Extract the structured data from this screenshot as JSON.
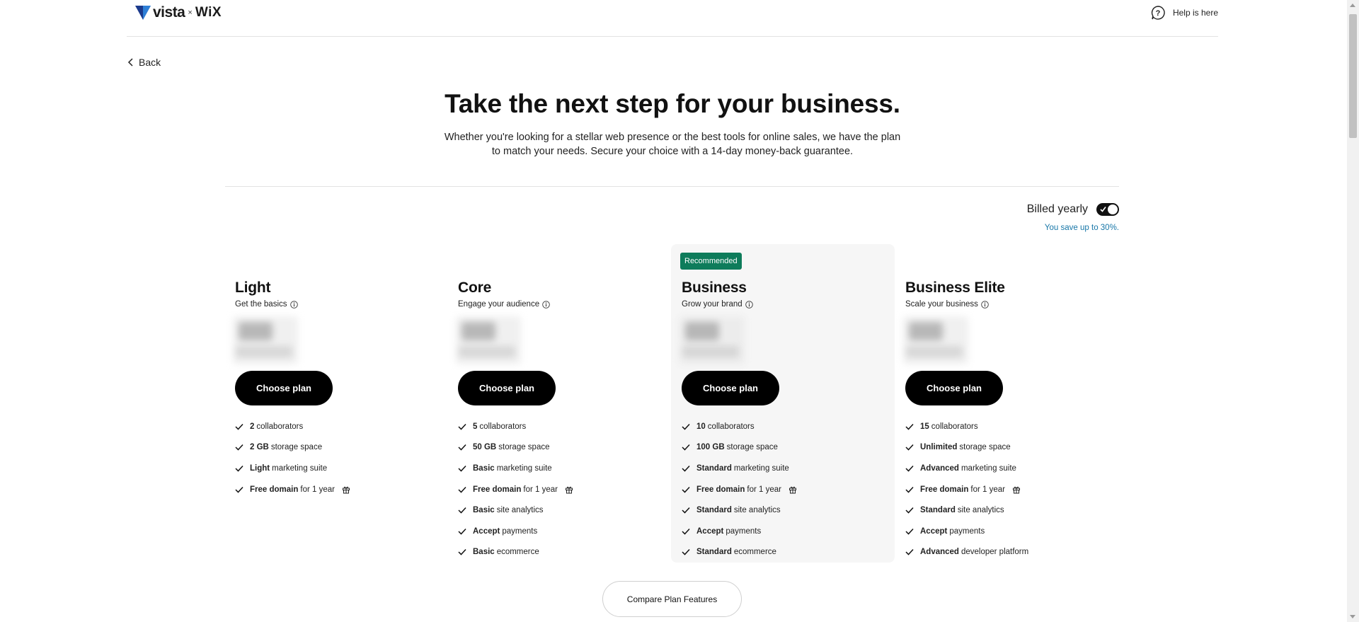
{
  "header": {
    "logo_vista": "vista",
    "logo_x": "×",
    "logo_wix": "WiX",
    "help_label": "Help is here"
  },
  "back_label": "Back",
  "hero": {
    "title": "Take the next step for your business.",
    "subtitle": "Whether you're looking for a stellar web presence or the best tools for online sales, we have the plan to match your needs. Secure your choice with a 14-day money-back guarantee."
  },
  "billing": {
    "label": "Billed yearly",
    "toggle_on": true,
    "save_note": "You save up to 30%."
  },
  "plans": [
    {
      "name": "Light",
      "tagline": "Get the basics",
      "cta": "Choose plan",
      "recommended": false,
      "features": [
        {
          "bold": "2",
          "text": "collaborators",
          "gift": false
        },
        {
          "bold": "2 GB",
          "text": "storage space",
          "gift": false
        },
        {
          "bold": "Light",
          "text": "marketing suite",
          "gift": false
        },
        {
          "bold": "Free domain",
          "text": "for 1 year",
          "gift": true
        }
      ]
    },
    {
      "name": "Core",
      "tagline": "Engage your audience",
      "cta": "Choose plan",
      "recommended": false,
      "features": [
        {
          "bold": "5",
          "text": "collaborators",
          "gift": false
        },
        {
          "bold": "50 GB",
          "text": "storage space",
          "gift": false
        },
        {
          "bold": "Basic",
          "text": "marketing suite",
          "gift": false
        },
        {
          "bold": "Free domain",
          "text": "for 1 year",
          "gift": true
        },
        {
          "bold": "Basic",
          "text": "site analytics",
          "gift": false
        },
        {
          "bold": "Accept",
          "text": "payments",
          "gift": false
        },
        {
          "bold": "Basic",
          "text": "ecommerce",
          "gift": false
        }
      ]
    },
    {
      "name": "Business",
      "tagline": "Grow your brand",
      "cta": "Choose plan",
      "recommended": true,
      "badge": "Recommended",
      "features": [
        {
          "bold": "10",
          "text": "collaborators",
          "gift": false
        },
        {
          "bold": "100 GB",
          "text": "storage space",
          "gift": false
        },
        {
          "bold": "Standard",
          "text": "marketing suite",
          "gift": false
        },
        {
          "bold": "Free domain",
          "text": "for 1 year",
          "gift": true
        },
        {
          "bold": "Standard",
          "text": "site analytics",
          "gift": false
        },
        {
          "bold": "Accept",
          "text": "payments",
          "gift": false
        },
        {
          "bold": "Standard",
          "text": "ecommerce",
          "gift": false
        }
      ]
    },
    {
      "name": "Business Elite",
      "tagline": "Scale your business",
      "cta": "Choose plan",
      "recommended": false,
      "features": [
        {
          "bold": "15",
          "text": "collaborators",
          "gift": false
        },
        {
          "bold": "Unlimited",
          "text": "storage space",
          "gift": false
        },
        {
          "bold": "Advanced",
          "text": "marketing suite",
          "gift": false
        },
        {
          "bold": "Free domain",
          "text": "for 1 year",
          "gift": true
        },
        {
          "bold": "Standard",
          "text": "site analytics",
          "gift": false
        },
        {
          "bold": "Accept",
          "text": "payments",
          "gift": false
        },
        {
          "bold": "Advanced",
          "text": "developer platform",
          "gift": false
        }
      ]
    }
  ],
  "compare_label": "Compare Plan Features",
  "colors": {
    "badge_green": "#0e7c5b",
    "save_note_blue": "#1877a8",
    "recommended_bg": "#f6f6f6"
  }
}
